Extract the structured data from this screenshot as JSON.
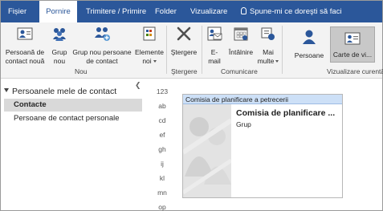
{
  "tabs": [
    {
      "label": "Fișier",
      "active": false
    },
    {
      "label": "Pornire",
      "active": true
    },
    {
      "label": "Trimitere / Primire",
      "active": false
    },
    {
      "label": "Folder",
      "active": false
    },
    {
      "label": "Vizualizare",
      "active": false
    }
  ],
  "tell_me": "Spune-mi ce doreşti să faci",
  "ribbon": {
    "new_contact": {
      "line1": "Persoană de",
      "line2": "contact nouă",
      "icon": "contact-card-icon"
    },
    "new_group": {
      "line1": "Grup",
      "line2": "nou",
      "icon": "people-group-icon"
    },
    "new_group_contacts": {
      "line1": "Grup nou persoane",
      "line2": "de contact",
      "icon": "contact-group-icon"
    },
    "new_items": {
      "line1": "Elemente",
      "line2": "noi",
      "icon": "new-items-icon"
    },
    "group_new": "Nou",
    "delete": {
      "label": "Ştergere",
      "icon": "delete-x-icon"
    },
    "group_delete": "Ştergere",
    "email": {
      "line1": "E-",
      "line2": "mail",
      "icon": "email-icon"
    },
    "meeting": {
      "line1": "Întâlnire",
      "icon": "meeting-calendar-icon"
    },
    "more": {
      "line1": "Mai",
      "line2": "multe",
      "icon": "more-icon"
    },
    "group_communicate": "Comunicare",
    "view_people": {
      "label": "Persoane",
      "icon": "people-view-icon"
    },
    "view_business_card": {
      "label": "Carte de vi...",
      "icon": "business-card-icon"
    },
    "group_current_view": "Vizualizare curentă"
  },
  "nav": {
    "header": "Persoanele mele de contact",
    "items": [
      {
        "label": "Contacte",
        "selected": true
      },
      {
        "label": "Persoane de contact personale",
        "selected": false
      }
    ]
  },
  "index_letters": [
    "123",
    "ab",
    "cd",
    "ef",
    "gh",
    "ij",
    "kl",
    "mn",
    "op"
  ],
  "card": {
    "header": "Comisia de planificare a petrecerii",
    "title": "Comisia de planificare ...",
    "subtitle": "Grup"
  },
  "colors": {
    "accent": "#2b579a",
    "ribbon_bg": "#f3f3f3",
    "selection": "#d9d9d9",
    "card_header": "#cde0f7"
  }
}
